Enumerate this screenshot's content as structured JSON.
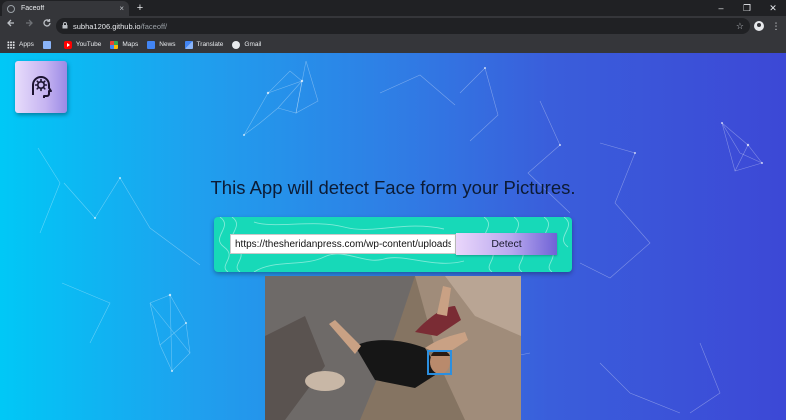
{
  "browser": {
    "tab_title": "Faceoff",
    "tab_close": "×",
    "new_tab": "+",
    "window_controls": [
      "–",
      "❐",
      "✕"
    ],
    "url_host": "subha1206.github.io",
    "url_path": "/faceoff/",
    "bookmarks": [
      {
        "label": "Apps",
        "icon": "apps-grid-icon"
      },
      {
        "label": "",
        "icon": "grid-icon"
      },
      {
        "label": "YouTube",
        "icon": "youtube-icon"
      },
      {
        "label": "Maps",
        "icon": "maps-icon"
      },
      {
        "label": "News",
        "icon": "news-icon"
      },
      {
        "label": "Translate",
        "icon": "translate-icon"
      },
      {
        "label": "Gmail",
        "icon": "gmail-icon"
      }
    ]
  },
  "page": {
    "headline": "This App will detect Face form your Pictures.",
    "url_input_value": "https://thesheridanpress.com/wp-content/uploads",
    "detect_label": "Detect",
    "logo_icon": "face-gear-icon",
    "colors": {
      "background_start": "#00c8f6",
      "background_end": "#3c48d6",
      "form_card": "#17d9b8",
      "face_box": "#2b8fe0"
    }
  }
}
